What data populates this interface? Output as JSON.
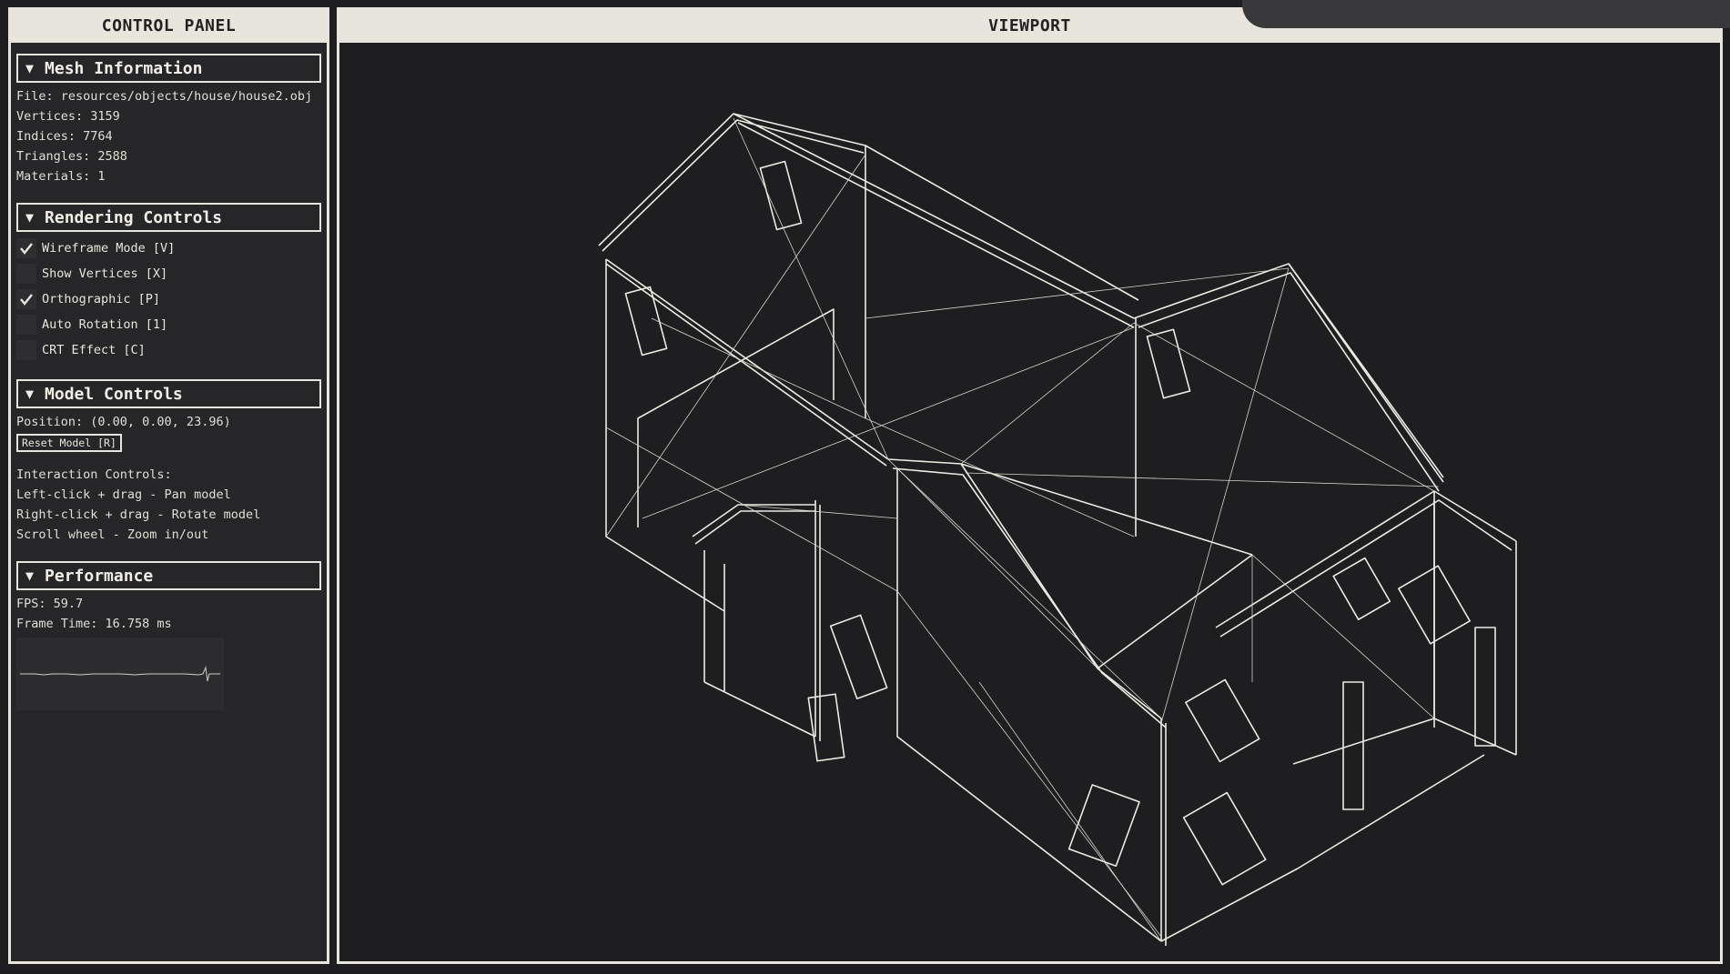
{
  "control_panel": {
    "title": "CONTROL PANEL",
    "mesh_info": {
      "header": "Mesh Information",
      "file": "File: resources/objects/house/house2.obj",
      "vertices": "Vertices: 3159",
      "indices": "Indices: 7764",
      "triangles": "Triangles: 2588",
      "materials": "Materials: 1"
    },
    "rendering": {
      "header": "Rendering Controls",
      "options": [
        {
          "label": "Wireframe Mode [V]",
          "checked": true
        },
        {
          "label": "Show Vertices [X]",
          "checked": false
        },
        {
          "label": "Orthographic [P]",
          "checked": true
        },
        {
          "label": "Auto Rotation [1]",
          "checked": false
        },
        {
          "label": "CRT Effect [C]",
          "checked": false
        }
      ]
    },
    "model": {
      "header": "Model Controls",
      "position": "Position: (0.00, 0.00, 23.96)",
      "reset_label": "Reset Model [R]",
      "interaction_title": "Interaction Controls:",
      "interactions": [
        "Left-click + drag - Pan model",
        "Right-click + drag - Rotate model",
        "Scroll wheel - Zoom in/out"
      ]
    },
    "performance": {
      "header": "Performance",
      "fps": "FPS: 59.7",
      "frame_time": "Frame Time: 16.758 ms"
    }
  },
  "viewport": {
    "title": "VIEWPORT"
  },
  "colors": {
    "accent": "#e8e6dc",
    "background": "#1e1e20",
    "panel": "#262628"
  },
  "icons": {
    "section": "triangle-down-icon",
    "check": "checkmark-icon"
  }
}
